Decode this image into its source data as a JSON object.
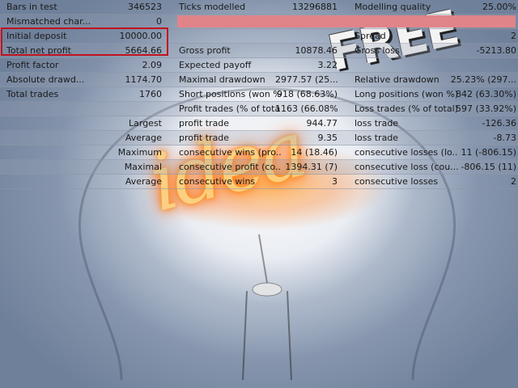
{
  "watermark": {
    "free_text": "FREE",
    "idea_text": "idea"
  },
  "rows": [
    {
      "l1": "Bars in test",
      "v1": "346523",
      "l2": "Ticks modelled",
      "v2": "13296881",
      "l3": "Modelling quality",
      "v3": "25.00%"
    },
    {
      "l1": "Mismatched char...",
      "v1": "0",
      "l2": "",
      "v2": "",
      "l3": "",
      "v3": ""
    },
    {
      "l1": "Initial deposit",
      "v1": "10000.00",
      "l2": "",
      "v2": "",
      "l3": "Spread",
      "v3": "2"
    },
    {
      "l1": "Total net profit",
      "v1": "5664.66",
      "l2": "Gross profit",
      "v2": "10878.46",
      "l3": "Gross loss",
      "v3": "-5213.80"
    },
    {
      "l1": "Profit factor",
      "v1": "2.09",
      "l2": "Expected payoff",
      "v2": "3.22",
      "l3": "",
      "v3": ""
    },
    {
      "l1": "Absolute drawd...",
      "v1": "1174.70",
      "l2": "Maximal drawdown",
      "v2": "2977.57 (25....",
      "l3": "Relative drawdown",
      "v3": "25.23% (297..."
    },
    {
      "l1": "Total trades",
      "v1": "1760",
      "l2": "Short positions (won %)",
      "v2": "918 (68.63%)",
      "l3": "Long positions (won %)",
      "v3": "842 (63.30%)"
    },
    {
      "l1": "",
      "v1": "",
      "l2": "Profit trades (% of total)",
      "v2": "1163 (66.08%)",
      "l3": "Loss trades (% of total)",
      "v3": "597 (33.92%)"
    },
    {
      "l1": "",
      "v1": "Largest",
      "l2": "profit trade",
      "v2": "944.77",
      "l3": "loss trade",
      "v3": "-126.36"
    },
    {
      "l1": "",
      "v1": "Average",
      "l2": "profit trade",
      "v2": "9.35",
      "l3": "loss trade",
      "v3": "-8.73"
    },
    {
      "l1": "",
      "v1": "Maximum",
      "l2": "consecutive wins (pro...",
      "v2": "14 (18.46)",
      "l3": "consecutive losses (lo...",
      "v3": "11 (-806.15)"
    },
    {
      "l1": "",
      "v1": "Maximal",
      "l2": "consecutive profit (co...",
      "v2": "1394.31 (7)",
      "l3": "consecutive loss (cou...",
      "v3": "-806.15 (11)"
    },
    {
      "l1": "",
      "v1": "Average",
      "l2": "consecutive wins",
      "v2": "3",
      "l3": "consecutive losses",
      "v3": "2"
    }
  ],
  "colors": {
    "highlight_box": "#c1121f",
    "quality_bar": "#e08489",
    "glow": "#ff8a00"
  }
}
